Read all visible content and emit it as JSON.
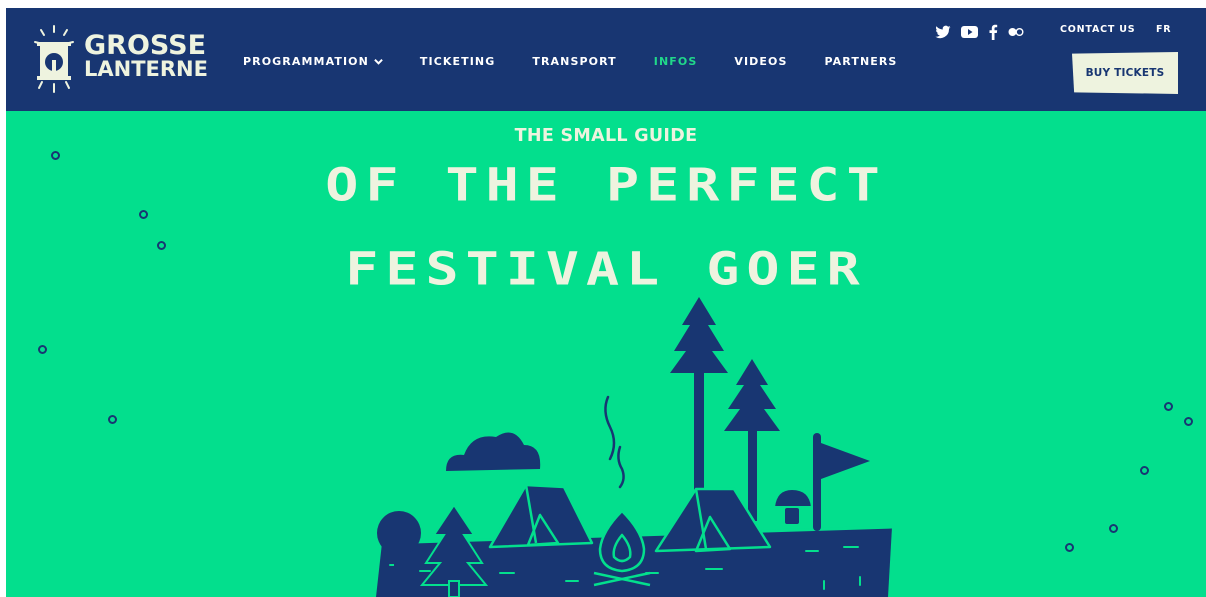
{
  "brand": {
    "line1": "GROSSE",
    "line2": "LANTERNE"
  },
  "nav": {
    "items": [
      {
        "label": "PROGRAMMATION",
        "has_dropdown": true,
        "active": false
      },
      {
        "label": "TICKETING",
        "has_dropdown": false,
        "active": false
      },
      {
        "label": "TRANSPORT",
        "has_dropdown": false,
        "active": false
      },
      {
        "label": "INFOS",
        "has_dropdown": false,
        "active": true
      },
      {
        "label": "VIDEOS",
        "has_dropdown": false,
        "active": false
      },
      {
        "label": "PARTNERS",
        "has_dropdown": false,
        "active": false
      }
    ]
  },
  "social": [
    "twitter-icon",
    "youtube-icon",
    "facebook-icon",
    "flickr-icon"
  ],
  "header_links": {
    "contact": "CONTACT US",
    "language": "FR",
    "buy": "BUY TICKETS"
  },
  "hero": {
    "kicker": "THE SMALL GUIDE",
    "line1": "OF THE PERFECT",
    "line2": "FESTIVAL GOER"
  },
  "colors": {
    "navy": "#183672",
    "green": "#03df8d",
    "cream": "#eef3df",
    "active_nav": "#20d88a"
  }
}
